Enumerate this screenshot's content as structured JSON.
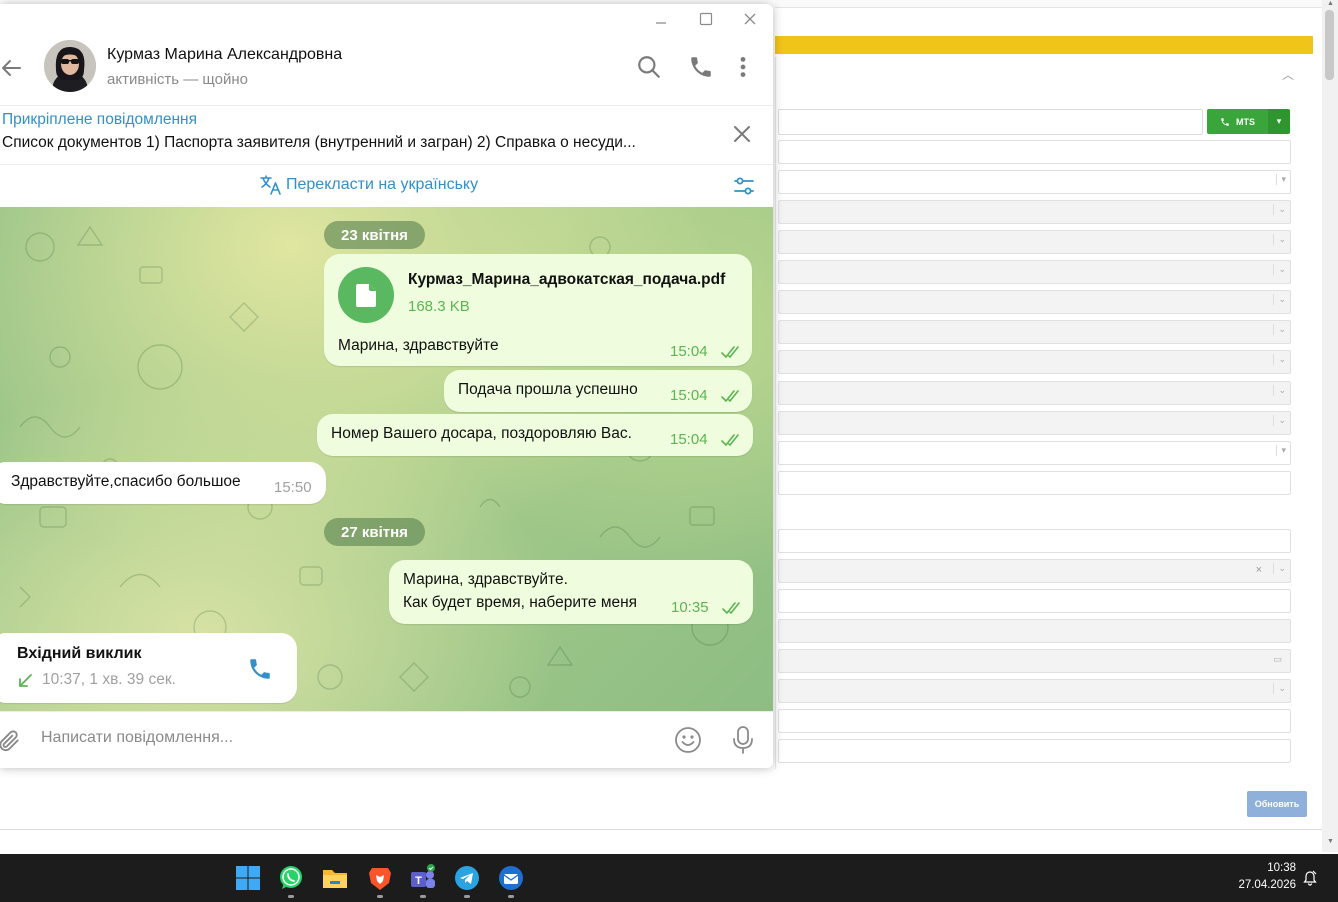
{
  "telegram": {
    "chat_name": "Курмаз Марина Александровна",
    "chat_status": "активність — щойно",
    "pinned_title": "Прикріплене повідомлення",
    "pinned_text": "Список документов    1) Паспорта заявителя (внутренний и загран) 2) Справка о несуди...",
    "translate_label": "Перекласти на українську",
    "messages": {
      "date1": "23 квітня",
      "file_name": "Курмаз_Марина_адвокатская_подача.pdf",
      "file_size": "168.3 KB",
      "m1_text": "Марина, здравствуйте",
      "m1_time": "15:04",
      "m2_text": "Подача прошла успешно",
      "m2_time": "15:04",
      "m3_text": "Номер Вашего досара, поздоровляю Вас.",
      "m3_time": "15:04",
      "m4_text": "Здравствуйте,спасибо большое",
      "m4_time": "15:50",
      "date2": "27 квітня",
      "m5_line1": "Марина, здравствуйте.",
      "m5_line2": "Как будет время, наберите меня",
      "m5_time": "10:35",
      "call_title": "Вхідний виклик",
      "call_detail": "10:37, 1 хв. 39 сек."
    },
    "composer_placeholder": "Написати повідомлення...",
    "accent_color": "#3390c8",
    "outgoing_bubble_color": "#effdde"
  },
  "background_app": {
    "mts_button": "MTS",
    "update_button": "Обновить"
  },
  "taskbar": {
    "icons": [
      "windows-start-icon",
      "whatsapp-icon",
      "file-explorer-icon",
      "brave-browser-icon",
      "teams-icon",
      "telegram-icon",
      "thunderbird-icon"
    ],
    "time": "10:38",
    "date": "27.04.2026"
  }
}
